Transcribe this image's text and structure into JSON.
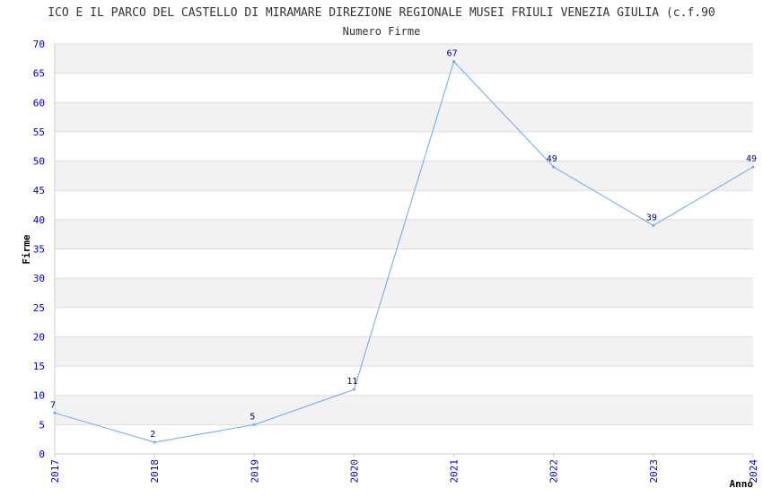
{
  "chart_data": {
    "type": "line",
    "title": "ICO E IL PARCO DEL CASTELLO DI MIRAMARE DIREZIONE REGIONALE MUSEI FRIULI VENEZIA GIULIA (c.f.90",
    "subtitle": "Numero Firme",
    "xlabel": "Anno",
    "ylabel": "Firme",
    "x": [
      "2017",
      "2018",
      "2019",
      "2020",
      "2021",
      "2022",
      "2023",
      "2024"
    ],
    "series": [
      {
        "values": [
          7,
          2,
          5,
          11,
          67,
          49,
          39,
          49
        ]
      }
    ],
    "ylim": [
      0,
      70
    ],
    "yticks": [
      0,
      5,
      10,
      15,
      20,
      25,
      30,
      35,
      40,
      45,
      50,
      55,
      60,
      65,
      70
    ],
    "grid": true,
    "legend": "none",
    "colors": {
      "line": "#66aaee",
      "band": "#f2f2f2",
      "grid": "#dddddd",
      "tick_text": "#0000cc",
      "data_label": "#000080"
    }
  }
}
